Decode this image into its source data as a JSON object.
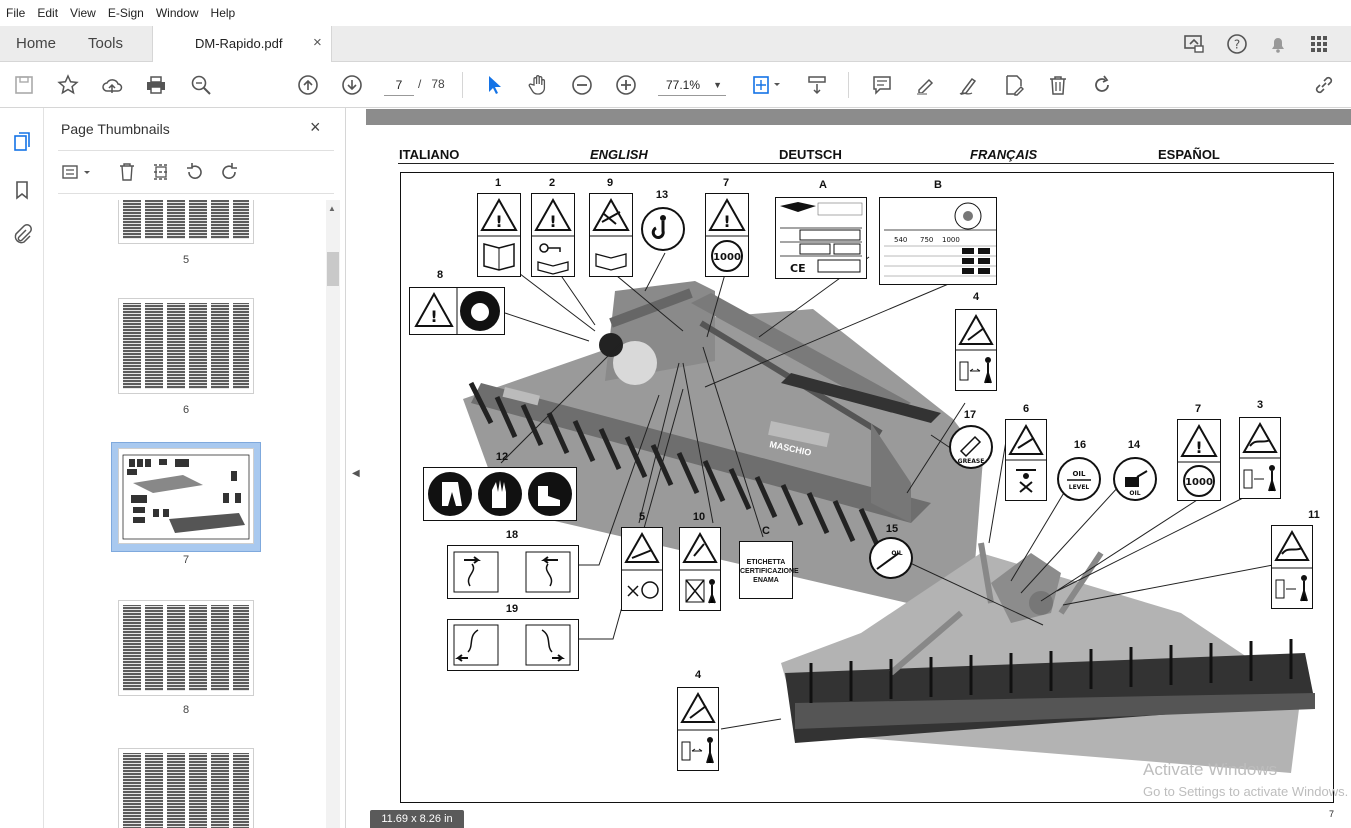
{
  "menu": [
    "File",
    "Edit",
    "View",
    "E-Sign",
    "Window",
    "Help"
  ],
  "tabs": {
    "home": "Home",
    "tools": "Tools",
    "document": "DM-Rapido.pdf",
    "close": "×"
  },
  "toolbar": {
    "current_page": "7",
    "page_sep": "/",
    "total_pages": "78",
    "zoom": "77.1%"
  },
  "thumbnails": {
    "title": "Page Thumbnails",
    "close": "×",
    "pages": [
      "5",
      "6",
      "7",
      "8"
    ],
    "selected": "7"
  },
  "document": {
    "languages": [
      "ITALIANO",
      "ENGLISH",
      "DEUTSCH",
      "FRANÇAIS",
      "ESPAÑOL"
    ],
    "page_number": "7",
    "callouts": [
      "1",
      "2",
      "9",
      "13",
      "7",
      "A",
      "B",
      "8",
      "4",
      "17",
      "6",
      "16",
      "14",
      "7",
      "3",
      "12",
      "5",
      "10",
      "C",
      "11",
      "18",
      "19",
      "15",
      "4"
    ],
    "label_c_text": "ETICHETTA CERTIFICAZIONE ENAMA",
    "grease_text": "GREASE",
    "oil_text": "OIL",
    "oil_level_text": "OIL LEVEL",
    "speed_text": "1000",
    "rpm_values": [
      "540",
      "750",
      "1000"
    ],
    "brand": "MASCHIO"
  },
  "status": {
    "page_size": "11.69 x 8.26 in"
  },
  "watermark": {
    "line1": "Activate Windows",
    "line2": "Go to Settings to activate Windows."
  },
  "colors": {
    "accent": "#1473e6",
    "selected_thumb": "#a9c9ef"
  }
}
